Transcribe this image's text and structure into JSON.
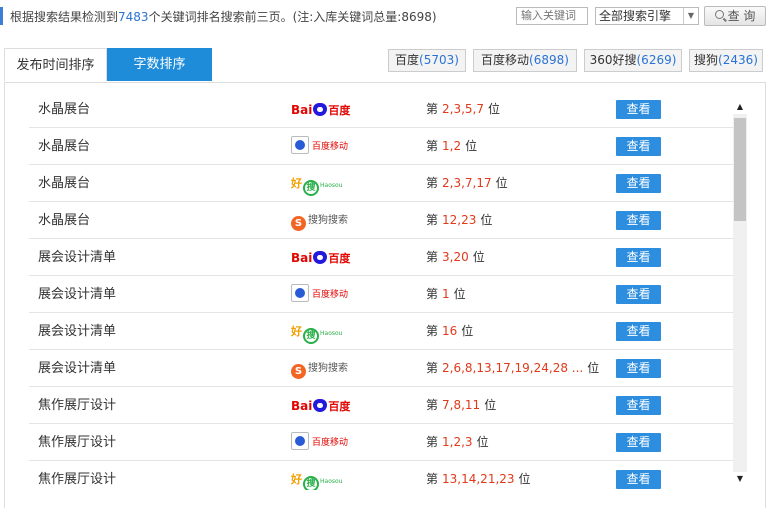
{
  "summary": {
    "prefix": "根据搜索结果检测到",
    "count": "7483",
    "suffix": "个关键词排名搜索前三页。(注:入库关键词总量:8698)"
  },
  "search": {
    "placeholder": "输入关键词",
    "engine_selected": "全部搜索引擎",
    "query_label": "查 询"
  },
  "tabs": [
    {
      "label": "发布时间排序",
      "active": false
    },
    {
      "label": "字数排序",
      "active": true
    }
  ],
  "engine_filters": [
    {
      "name": "百度",
      "count": "(5703)"
    },
    {
      "name": "百度移动",
      "count": "(6898)"
    },
    {
      "name": "360好搜",
      "count": "(6269)"
    },
    {
      "name": "搜狗",
      "count": "(2436)"
    }
  ],
  "logos": {
    "baidu": {
      "a": "Bai",
      "b": "百度"
    },
    "baidu_mobile": {
      "a": "百度移动"
    },
    "haosou": {
      "a": "好",
      "b": "搜",
      "c": "Haosou"
    },
    "sogou": {
      "a": "S",
      "b": "搜狗搜索"
    }
  },
  "rank_labels": {
    "pre": "第",
    "post": "位"
  },
  "view_label": "查看",
  "rows": [
    {
      "keyword": "水晶展台",
      "engine": "baidu",
      "positions": "2,3,5,7"
    },
    {
      "keyword": "水晶展台",
      "engine": "baidu_mobile",
      "positions": "1,2"
    },
    {
      "keyword": "水晶展台",
      "engine": "haosou",
      "positions": "2,3,7,17"
    },
    {
      "keyword": "水晶展台",
      "engine": "sogou",
      "positions": "12,23"
    },
    {
      "keyword": "展会设计清单",
      "engine": "baidu",
      "positions": "3,20"
    },
    {
      "keyword": "展会设计清单",
      "engine": "baidu_mobile",
      "positions": "1"
    },
    {
      "keyword": "展会设计清单",
      "engine": "haosou",
      "positions": "16"
    },
    {
      "keyword": "展会设计清单",
      "engine": "sogou",
      "positions": "2,6,8,13,17,19,24,28 ..."
    },
    {
      "keyword": "焦作展厅设计",
      "engine": "baidu",
      "positions": "7,8,11"
    },
    {
      "keyword": "焦作展厅设计",
      "engine": "baidu_mobile",
      "positions": "1,2,3"
    },
    {
      "keyword": "焦作展厅设计",
      "engine": "haosou",
      "positions": "13,14,21,23"
    }
  ]
}
